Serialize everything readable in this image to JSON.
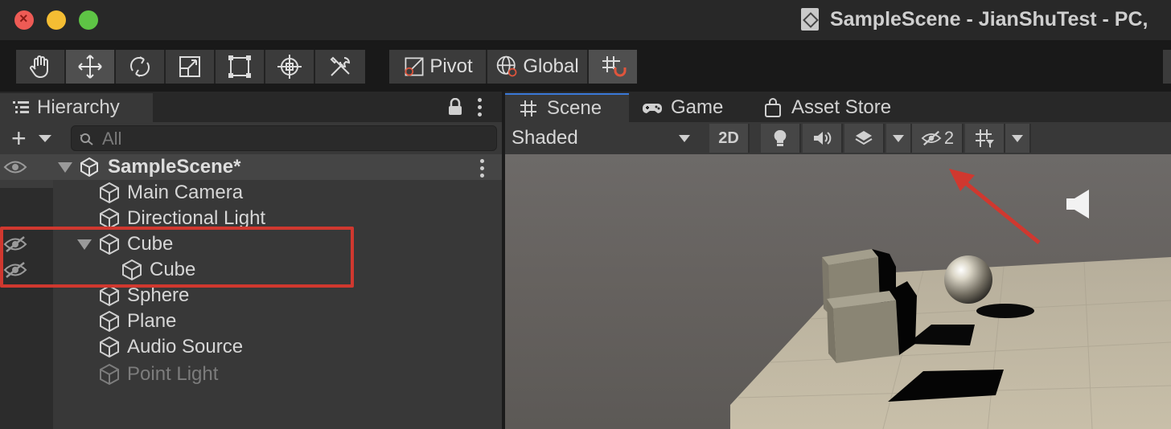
{
  "window": {
    "title": "SampleScene - JianShuTest - PC,"
  },
  "toolbar": {
    "tools": [
      "hand-tool",
      "move-tool",
      "rotate-tool",
      "scale-tool",
      "rect-tool",
      "transform-tool",
      "custom-tool"
    ],
    "pivot_label": "Pivot",
    "global_label": "Global"
  },
  "hierarchy": {
    "tab_label": "Hierarchy",
    "search_placeholder": "All",
    "scene_name": "SampleScene*",
    "items": [
      {
        "label": "Main Camera"
      },
      {
        "label": "Directional Light"
      },
      {
        "label": "Cube",
        "hidden": true
      },
      {
        "label": "Cube",
        "hidden": true
      },
      {
        "label": "Sphere"
      },
      {
        "label": "Plane"
      },
      {
        "label": "Audio Source"
      },
      {
        "label": "Point Light",
        "disabled": true
      }
    ]
  },
  "scene_view": {
    "tabs": [
      "Scene",
      "Game",
      "Asset Store"
    ],
    "draw_mode": "Shaded",
    "mode_2d": "2D",
    "hidden_count": "2"
  },
  "colors": {
    "highlight": "#d0382f",
    "active_tab_accent": "#3a79d8",
    "ground": "#c2b9a4"
  }
}
